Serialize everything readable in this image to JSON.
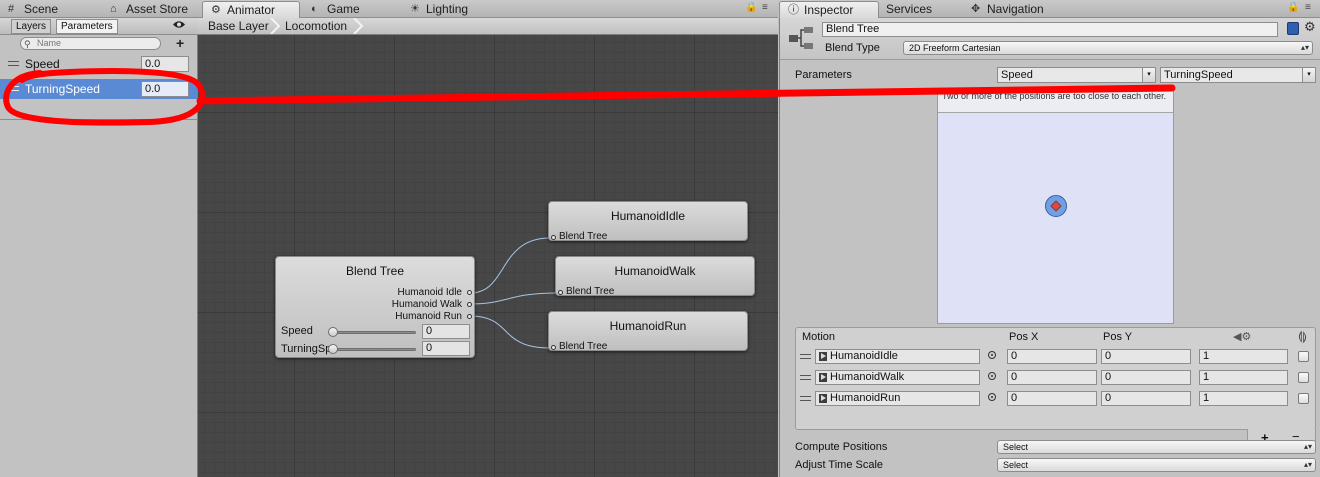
{
  "top_tabs_left": [
    {
      "label": "Scene",
      "icon": "#"
    },
    {
      "label": "Asset Store",
      "icon": "⌂"
    },
    {
      "label": "Animator",
      "icon": "⚙"
    },
    {
      "label": "Game",
      "icon": "◐"
    },
    {
      "label": "Lighting",
      "icon": "☀"
    }
  ],
  "top_tabs_right": [
    {
      "label": "Inspector",
      "icon": "ⓘ"
    },
    {
      "label": "Services",
      "icon": ""
    },
    {
      "label": "Navigation",
      "icon": "✥"
    }
  ],
  "left_panel": {
    "subtabs": [
      "Layers",
      "Parameters"
    ],
    "search_placeholder": "Name",
    "add_symbol": "+",
    "parameters": [
      {
        "name": "Speed",
        "value": "0.0"
      },
      {
        "name": "TurningSpeed",
        "value": "0.0"
      }
    ]
  },
  "breadcrumb": [
    "Base Layer",
    "Locomotion"
  ],
  "graph": {
    "blend_tree_node": {
      "title": "Blend Tree",
      "outputs": [
        "Humanoid Idle",
        "Humanoid Walk",
        "Humanoid Run"
      ],
      "params": [
        {
          "label": "Speed",
          "value": "0",
          "fraction": 0.0
        },
        {
          "label": "TurningSpeed",
          "value": "0",
          "fraction": 0.0
        }
      ]
    },
    "clip_nodes": [
      {
        "title": "HumanoidIdle",
        "port": "Blend Tree"
      },
      {
        "title": "HumanoidWalk",
        "port": "Blend Tree"
      },
      {
        "title": "HumanoidRun",
        "port": "Blend Tree"
      }
    ]
  },
  "inspector": {
    "name": "Blend Tree",
    "blend_type_label": "Blend Type",
    "blend_type_value": "2D Freeform Cartesian",
    "parameters_label": "Parameters",
    "param_x": "Speed",
    "param_y": "TurningSpeed",
    "warning": "Two or more of the positions are too close to each other.",
    "table_headers": {
      "motion": "Motion",
      "pos_x": "Pos X",
      "pos_y": "Pos Y"
    },
    "motions": [
      {
        "clip": "HumanoidIdle",
        "pos_x": "0",
        "pos_y": "0",
        "speed": "1"
      },
      {
        "clip": "HumanoidWalk",
        "pos_x": "0",
        "pos_y": "0",
        "speed": "1"
      },
      {
        "clip": "HumanoidRun",
        "pos_x": "0",
        "pos_y": "0",
        "speed": "1"
      }
    ],
    "footer_add": "+.",
    "footer_remove": "−",
    "compute_positions_label": "Compute Positions",
    "compute_positions_value": "Select",
    "adjust_time_label": "Adjust Time Scale",
    "adjust_time_value": "Select"
  },
  "annotation_color": "#ff0000"
}
